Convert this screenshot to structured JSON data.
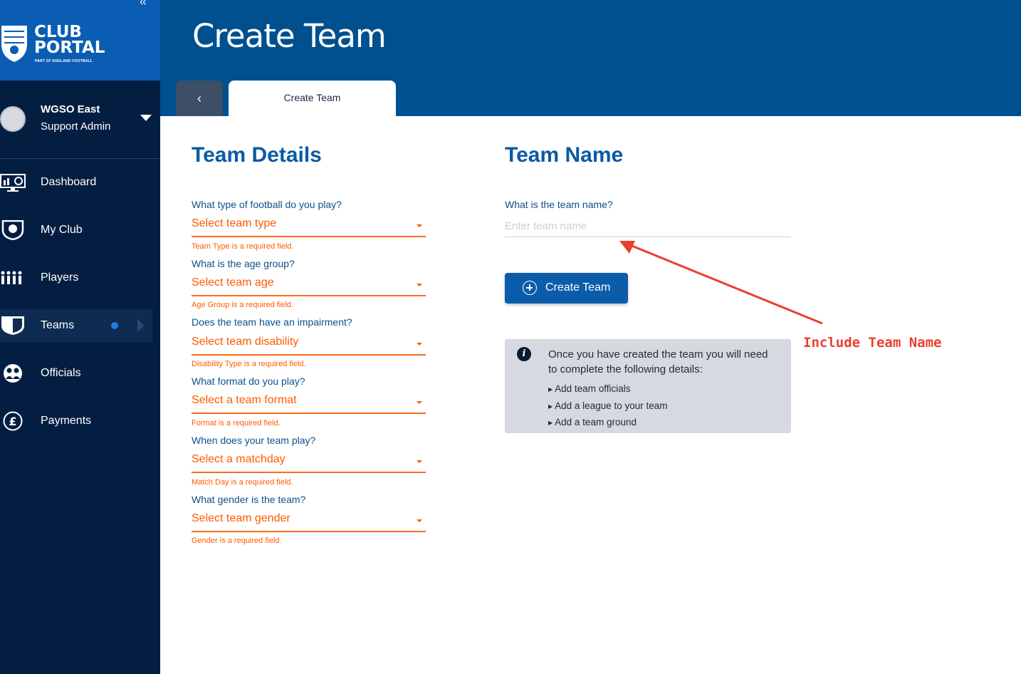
{
  "brand": {
    "title_line1": "CLUB",
    "title_line2": "PORTAL",
    "subtitle": "PART OF ENGLAND FOOTBALL"
  },
  "user": {
    "name": "WGSO East",
    "role": "Support Admin"
  },
  "nav": {
    "items": [
      {
        "label": "Dashboard",
        "icon": "dashboard-icon"
      },
      {
        "label": "My Club",
        "icon": "club-shield-icon"
      },
      {
        "label": "Players",
        "icon": "players-icon"
      },
      {
        "label": "Teams",
        "icon": "teams-shield-icon",
        "active": true
      },
      {
        "label": "Officials",
        "icon": "officials-icon"
      },
      {
        "label": "Payments",
        "icon": "pound-icon"
      }
    ]
  },
  "header": {
    "title": "Create Team",
    "back_label": "‹",
    "tab_label": "Create Team"
  },
  "team_details": {
    "title": "Team Details",
    "fields": [
      {
        "question": "What type of football do you play?",
        "placeholder": "Select team type",
        "error": "Team Type is a required field."
      },
      {
        "question": "What is the age group?",
        "placeholder": "Select team age",
        "error": "Age Group is a required field."
      },
      {
        "question": "Does the team have an impairment?",
        "placeholder": "Select team disability",
        "error": "Disability Type is a required field."
      },
      {
        "question": "What format do you play?",
        "placeholder": "Select a team format",
        "error": "Format is a required field."
      },
      {
        "question": "When does your team play?",
        "placeholder": "Select a matchday",
        "error": "Match Day is a required field."
      },
      {
        "question": "What gender is the team?",
        "placeholder": "Select team gender",
        "error": "Gender is a required field."
      }
    ]
  },
  "team_name": {
    "title": "Team Name",
    "question": "What is the team name?",
    "input_placeholder": "Enter team name",
    "input_value": "",
    "create_button": "Create Team"
  },
  "info": {
    "text": "Once you have created the team you will need to complete the following details:",
    "items": [
      "Add team officials",
      "Add a league to your team",
      "Add a team ground"
    ]
  },
  "annotation": {
    "text": "Include Team Name",
    "color": "#e8402f"
  },
  "colors": {
    "sidebar": "#041e42",
    "header": "#00508f",
    "accent": "#0a5aa5",
    "error": "#ff5a00"
  }
}
